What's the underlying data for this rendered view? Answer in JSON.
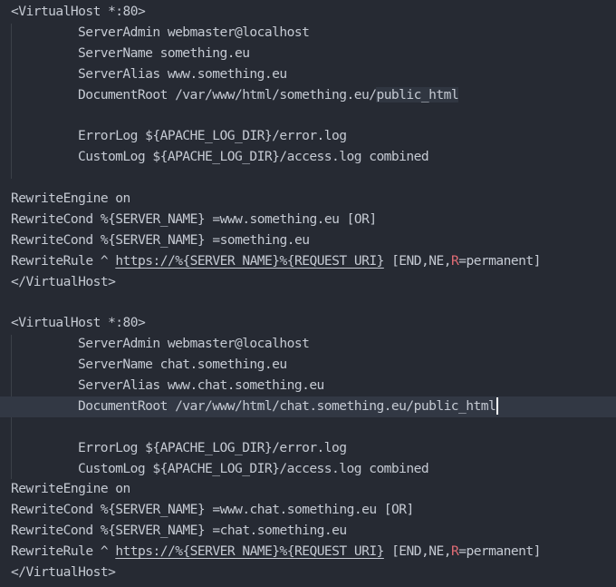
{
  "editor": {
    "block1": {
      "open_tag": "<VirtualHost *:80>",
      "server_admin": "ServerAdmin webmaster@localhost",
      "server_name": "ServerName something.eu",
      "server_alias": "ServerAlias www.something.eu",
      "document_root_prefix": "DocumentRoot /var/www/html/something.eu/",
      "document_root_selected": "public_html",
      "error_log": "ErrorLog ${APACHE_LOG_DIR}/error.log",
      "custom_log": "CustomLog ${APACHE_LOG_DIR}/access.log combined",
      "rewrite_engine": "RewriteEngine on",
      "rewrite_cond_1": "RewriteCond %{SERVER_NAME} =www.something.eu [OR]",
      "rewrite_cond_2": "RewriteCond %{SERVER_NAME} =something.eu",
      "rewrite_rule_prefix": "RewriteRule ^ ",
      "rewrite_rule_url": "https://%{SERVER_NAME}%{REQUEST_URI}",
      "rewrite_rule_flags_start": " [END,NE,",
      "rewrite_rule_flag_r": "R",
      "rewrite_rule_flags_end": "=permanent]",
      "close_tag": "</VirtualHost>"
    },
    "block2": {
      "open_tag": "<VirtualHost *:80>",
      "server_admin": "ServerAdmin webmaster@localhost",
      "server_name": "ServerName chat.something.eu",
      "server_alias": "ServerAlias www.chat.something.eu",
      "document_root": "DocumentRoot /var/www/html/chat.something.eu/public_html",
      "error_log": "ErrorLog ${APACHE_LOG_DIR}/error.log",
      "custom_log": "CustomLog ${APACHE_LOG_DIR}/access.log combined",
      "rewrite_engine": "RewriteEngine on",
      "rewrite_cond_1": "RewriteCond %{SERVER_NAME} =www.chat.something.eu [OR]",
      "rewrite_cond_2": "RewriteCond %{SERVER_NAME} =chat.something.eu",
      "rewrite_rule_prefix": "RewriteRule ^ ",
      "rewrite_rule_url": "https://%{SERVER_NAME}%{REQUEST_URI}",
      "rewrite_rule_flags_start": " [END,NE,",
      "rewrite_rule_flag_r": "R",
      "rewrite_rule_flags_end": "=permanent]",
      "close_tag": "</VirtualHost>"
    }
  }
}
